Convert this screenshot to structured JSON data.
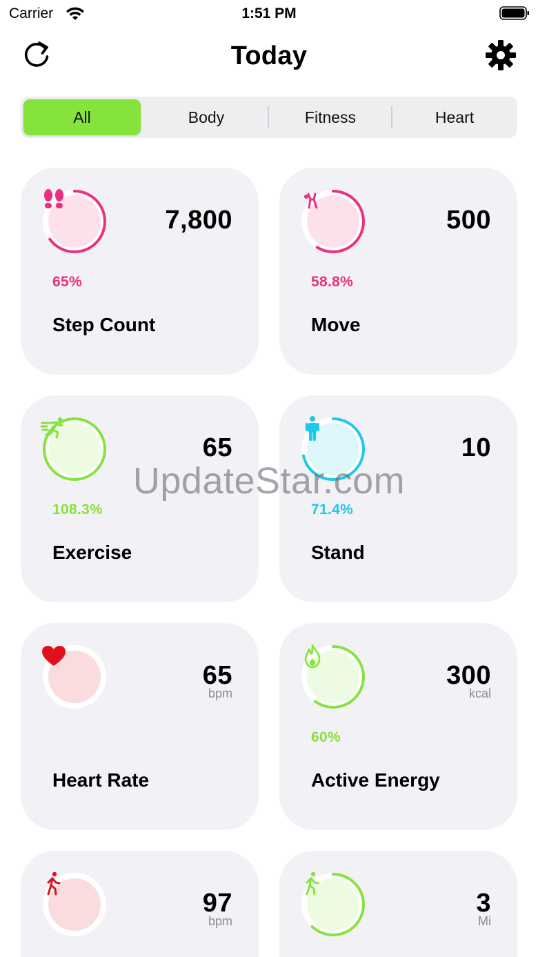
{
  "status_bar": {
    "carrier": "Carrier",
    "time": "1:51 PM"
  },
  "nav": {
    "title": "Today",
    "left_icon": "refresh-icon",
    "right_icon": "gear-icon"
  },
  "segments": {
    "items": [
      "All",
      "Body",
      "Fitness",
      "Heart"
    ],
    "selected": "All",
    "active_color": "#86e33c"
  },
  "cards": [
    {
      "label": "Step Count",
      "value": "7,800",
      "unit": "",
      "percent": "65%",
      "progress": 0.65,
      "color": "#ec2f80",
      "icon": "footprints-icon"
    },
    {
      "label": "Move",
      "value": "500",
      "unit": "",
      "percent": "58.8%",
      "progress": 0.588,
      "color": "#ec2f80",
      "icon": "move-figure-icon"
    },
    {
      "label": "Exercise",
      "value": "65",
      "unit": "",
      "percent": "108.3%",
      "progress": 1.0,
      "color": "#86e33c",
      "icon": "running-icon"
    },
    {
      "label": "Stand",
      "value": "10",
      "unit": "",
      "percent": "71.4%",
      "progress": 0.714,
      "color": "#1ec8ec",
      "icon": "standing-person-icon"
    },
    {
      "label": "Heart Rate",
      "value": "65",
      "unit": "bpm",
      "percent": "",
      "progress": 0,
      "color": "#e0101f",
      "icon": "heart-icon"
    },
    {
      "label": "Active Energy",
      "value": "300",
      "unit": "kcal",
      "percent": "60%",
      "progress": 0.6,
      "color": "#86e33c",
      "icon": "flame-icon"
    },
    {
      "label": "",
      "value": "97",
      "unit": "bpm",
      "percent": "",
      "progress": 0,
      "color": "#e0101f",
      "icon": "walking-heart-icon"
    },
    {
      "label": "",
      "value": "3",
      "unit": "Mi",
      "percent": "",
      "progress": 0.62,
      "color": "#86e33c",
      "icon": "walking-person-icon"
    }
  ],
  "watermark": "UpdateStar.com"
}
